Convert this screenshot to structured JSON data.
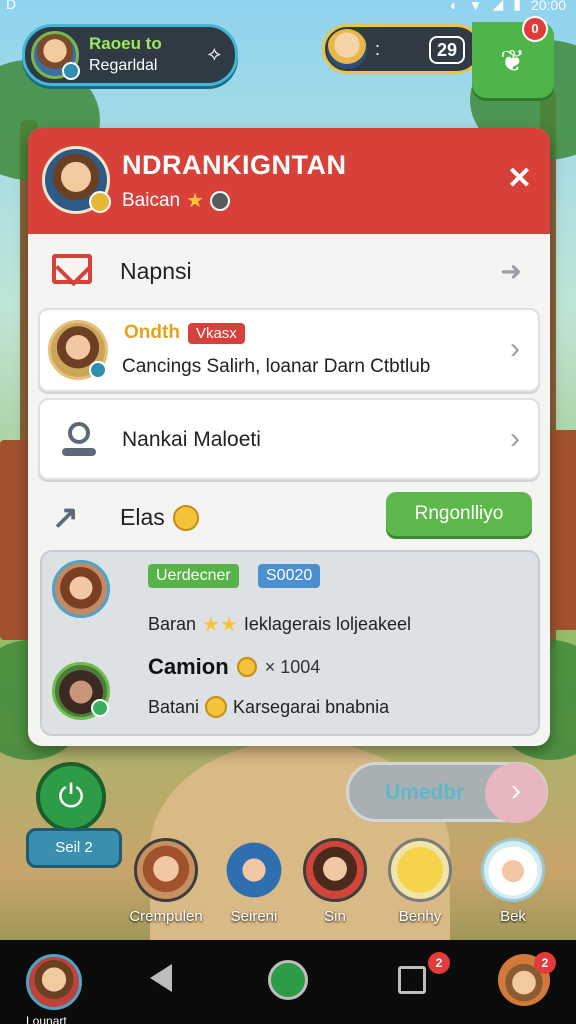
{
  "status_bar": {
    "left": "D",
    "right_icons": [
      "circle-icon",
      "wifi-icon",
      "signal-icon",
      "battery-icon"
    ],
    "time": "20:00"
  },
  "player": {
    "name": "Raoeu to",
    "subtitle": "Regarldal",
    "arrow": "⟡"
  },
  "top_counter": {
    "colon": ":",
    "count": "29"
  },
  "gift": {
    "badge": "0"
  },
  "panel": {
    "title": "NDRANKIGNTAN",
    "subtitle": "Baican",
    "close": "✕",
    "mail": {
      "label": "Napnsi",
      "arrow": "➜"
    },
    "card1": {
      "name": "Ondth",
      "tag": "Vkasx",
      "desc": "Cancings Salirh, loanar Darn Ctbtlub",
      "chevron": "›"
    },
    "card2": {
      "label": "Nankai Maloeti",
      "chevron": "›"
    },
    "trend": {
      "label": "Elas",
      "button": "Rngonlliyo"
    },
    "friends": [
      {
        "tag_green": "Uerdecner",
        "tag_blue": "S0020",
        "line": "Baran",
        "line_rest": "Ieklagerais loljeakeel"
      },
      {
        "name": "Camion",
        "score": "× 1004",
        "line": "Batani",
        "line_rest": "Karsegarai bnabnia"
      }
    ]
  },
  "power": {
    "label": "Seil 2"
  },
  "next_pill": {
    "label": "Umedbr",
    "arrow": "›"
  },
  "quick_friends": [
    "Crempulen",
    "Seireni",
    "Sin",
    "Benhy",
    "Bek"
  ],
  "navbar": {
    "avatar_label": "Lounart",
    "recents_badge": "2",
    "profile_badge": "2"
  },
  "colors": {
    "header_red": "#d8403a",
    "accent_green": "#5cb84a",
    "accent_blue": "#4a8fd0"
  }
}
